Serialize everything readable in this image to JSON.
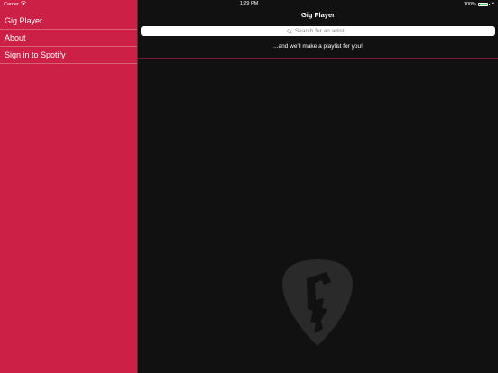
{
  "status_bar": {
    "carrier": "Carrier",
    "time": "1:29 PM",
    "battery": "100%",
    "battery_level": 1.0
  },
  "sidebar": {
    "items": [
      {
        "label": "Gig Player"
      },
      {
        "label": "About"
      },
      {
        "label": "Sign in to Spotify"
      }
    ]
  },
  "main": {
    "title": "Gig Player",
    "search": {
      "placeholder": "Search for an artist..."
    },
    "subtitle": "...and we'll make a playlist for you!"
  },
  "colors": {
    "sidebar_bg": "#cd2046",
    "main_bg": "#111111",
    "accent_rule": "#7a1b2c",
    "battery_green": "#4cd964"
  },
  "icons": {
    "search": "search-icon",
    "wifi": "wifi-icon",
    "battery": "battery-icon",
    "logo": "guitar-pick-logo-icon"
  }
}
